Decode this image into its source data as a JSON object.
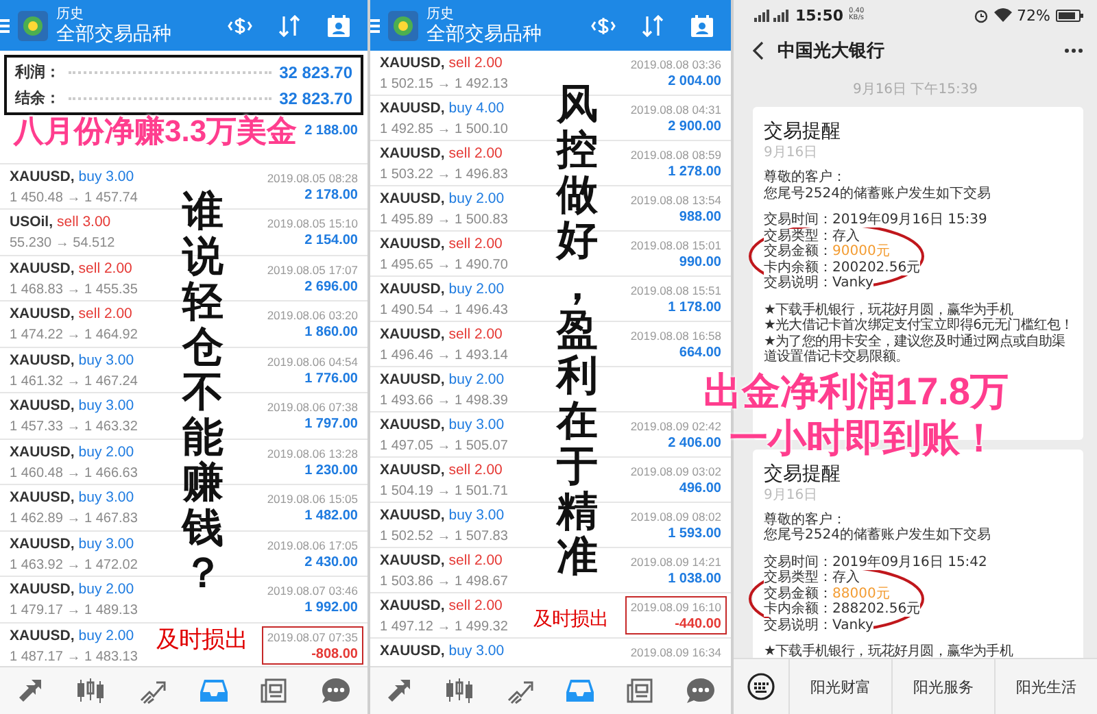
{
  "panels": [
    {
      "kind": "history",
      "header": {
        "subtitle": "历史",
        "title": "全部交易品种"
      },
      "summary": [
        {
          "label": "利润：",
          "value": "32 823.70"
        },
        {
          "label": "结余：",
          "value": "32 823.70"
        }
      ],
      "trades": [
        {
          "profit": "2 188.00",
          "loss": false,
          "flagged": false
        },
        {
          "symbol": "XAUUSD,",
          "color": "#1e7be0",
          "order": "buy 3.00",
          "prices": "1 450.48 → 1 457.74",
          "time": "2019.08.05 08:28",
          "profit": "2 178.00",
          "loss": false,
          "flagged": false
        },
        {
          "symbol": "USOil,",
          "color": "#e53935",
          "order": "sell 3.00",
          "prices": "55.230 → 54.512",
          "time": "2019.08.05 15:10",
          "profit": "2 154.00",
          "loss": false,
          "flagged": false
        },
        {
          "symbol": "XAUUSD,",
          "color": "#e53935",
          "order": "sell 2.00",
          "prices": "1 468.83 → 1 455.35",
          "time": "2019.08.05 17:07",
          "profit": "2 696.00",
          "loss": false,
          "flagged": false
        },
        {
          "symbol": "XAUUSD,",
          "color": "#e53935",
          "order": "sell 2.00",
          "prices": "1 474.22 → 1 464.92",
          "time": "2019.08.06 03:20",
          "profit": "1 860.00",
          "loss": false,
          "flagged": false
        },
        {
          "symbol": "XAUUSD,",
          "color": "#1e7be0",
          "order": "buy 3.00",
          "prices": "1 461.32 → 1 467.24",
          "time": "2019.08.06 04:54",
          "profit": "1 776.00",
          "loss": false,
          "flagged": false
        },
        {
          "symbol": "XAUUSD,",
          "color": "#1e7be0",
          "order": "buy 3.00",
          "prices": "1 457.33 → 1 463.32",
          "time": "2019.08.06 07:38",
          "profit": "1 797.00",
          "loss": false,
          "flagged": false
        },
        {
          "symbol": "XAUUSD,",
          "color": "#1e7be0",
          "order": "buy 2.00",
          "prices": "1 460.48 → 1 466.63",
          "time": "2019.08.06 13:28",
          "profit": "1 230.00",
          "loss": false,
          "flagged": false
        },
        {
          "symbol": "XAUUSD,",
          "color": "#1e7be0",
          "order": "buy 3.00",
          "prices": "1 462.89 → 1 467.83",
          "time": "2019.08.06 15:05",
          "profit": "1 482.00",
          "loss": false,
          "flagged": false
        },
        {
          "symbol": "XAUUSD,",
          "color": "#1e7be0",
          "order": "buy 3.00",
          "prices": "1 463.92 → 1 472.02",
          "time": "2019.08.06 17:05",
          "profit": "2 430.00",
          "loss": false,
          "flagged": false
        },
        {
          "symbol": "XAUUSD,",
          "color": "#1e7be0",
          "order": "buy 2.00",
          "prices": "1 479.17 → 1 489.13",
          "time": "2019.08.07 03:46",
          "profit": "1 992.00",
          "loss": false,
          "flagged": false
        },
        {
          "symbol": "XAUUSD,",
          "color": "#1e7be0",
          "order": "buy 2.00",
          "prices": "1 487.17 → 1 483.13",
          "time": "2019.08.07 07:35",
          "profit": "-808.00",
          "loss": true,
          "flagged": true
        }
      ],
      "nav": [
        {
          "selected": false
        },
        {
          "selected": false
        },
        {
          "selected": false
        },
        {
          "selected": true
        },
        {
          "selected": false
        },
        {
          "selected": false
        }
      ]
    },
    {
      "kind": "history",
      "header": {
        "subtitle": "历史",
        "title": "全部交易品种"
      },
      "trades": [
        {
          "symbol": "XAUUSD,",
          "color": "#e53935",
          "order": "sell 2.00",
          "prices": "1 502.15 → 1 492.13",
          "time": "2019.08.08 03:36",
          "profit": "2 004.00",
          "loss": false,
          "flagged": false
        },
        {
          "symbol": "XAUUSD,",
          "color": "#1e7be0",
          "order": "buy 4.00",
          "prices": "1 492.85 → 1 500.10",
          "time": "2019.08.08 04:31",
          "profit": "2 900.00",
          "loss": false,
          "flagged": false
        },
        {
          "symbol": "XAUUSD,",
          "color": "#e53935",
          "order": "sell 2.00",
          "prices": "1 503.22 → 1 496.83",
          "time": "2019.08.08 08:59",
          "profit": "1 278.00",
          "loss": false,
          "flagged": false
        },
        {
          "symbol": "XAUUSD,",
          "color": "#1e7be0",
          "order": "buy 2.00",
          "prices": "1 495.89 → 1 500.83",
          "time": "2019.08.08 13:54",
          "profit": "988.00",
          "loss": false,
          "flagged": false
        },
        {
          "symbol": "XAUUSD,",
          "color": "#e53935",
          "order": "sell 2.00",
          "prices": "1 495.65 → 1 490.70",
          "time": "2019.08.08 15:01",
          "profit": "990.00",
          "loss": false,
          "flagged": false
        },
        {
          "symbol": "XAUUSD,",
          "color": "#1e7be0",
          "order": "buy 2.00",
          "prices": "1 490.54 → 1 496.43",
          "time": "2019.08.08 15:51",
          "profit": "1 178.00",
          "loss": false,
          "flagged": false
        },
        {
          "symbol": "XAUUSD,",
          "color": "#e53935",
          "order": "sell 2.00",
          "prices": "1 496.46 → 1 493.14",
          "time": "2019.08.08 16:58",
          "profit": "664.00",
          "loss": false,
          "flagged": false
        },
        {
          "symbol": "XAUUSD,",
          "color": "#1e7be0",
          "order": "buy 2.00",
          "prices": "1 493.66 → 1 498.39",
          "flagged": false
        },
        {
          "symbol": "XAUUSD,",
          "color": "#1e7be0",
          "order": "buy 3.00",
          "prices": "1 497.05 → 1 505.07",
          "time": "2019.08.09 02:42",
          "profit": "2 406.00",
          "loss": false,
          "flagged": false
        },
        {
          "symbol": "XAUUSD,",
          "color": "#e53935",
          "order": "sell 2.00",
          "prices": "1 504.19 → 1 501.71",
          "time": "2019.08.09 03:02",
          "profit": "496.00",
          "loss": false,
          "flagged": false
        },
        {
          "symbol": "XAUUSD,",
          "color": "#1e7be0",
          "order": "buy 3.00",
          "prices": "1 502.52 → 1 507.83",
          "time": "2019.08.09 08:02",
          "profit": "1 593.00",
          "loss": false,
          "flagged": false
        },
        {
          "symbol": "XAUUSD,",
          "color": "#e53935",
          "order": "sell 2.00",
          "prices": "1 503.86 → 1 498.67",
          "time": "2019.08.09 14:21",
          "profit": "1 038.00",
          "loss": false,
          "flagged": false
        },
        {
          "symbol": "XAUUSD,",
          "color": "#e53935",
          "order": "sell 2.00",
          "prices": "1 497.12 → 1 499.32",
          "time": "2019.08.09 16:10",
          "profit": "-440.00",
          "loss": true,
          "flagged": true
        },
        {
          "symbol": "XAUUSD,",
          "color": "#1e7be0",
          "order": "buy 3.00",
          "time": "2019.08.09 16:34",
          "flagged": false
        }
      ],
      "nav": [
        {
          "selected": false
        },
        {
          "selected": false
        },
        {
          "selected": false
        },
        {
          "selected": true
        },
        {
          "selected": false
        },
        {
          "selected": false
        }
      ]
    },
    {
      "kind": "bank",
      "status_bar": {
        "time": "15:50",
        "speed": "0.40 KB/s",
        "battery": "72%"
      },
      "title": "中国光大银行",
      "timestamp": "9月16日 下午15:39",
      "messages": [
        {
          "title": "交易提醒",
          "date": "9月16日",
          "annotated": true,
          "intro": [
            "尊敬的客户：",
            "您尾号2524的储蓄账户发生如下交易"
          ],
          "fields": [
            {
              "label": "交易时间：",
              "value": "2019年09月16日  15:39",
              "highlight": false
            },
            {
              "label": "交易类型：",
              "value": "存入",
              "highlight": false
            },
            {
              "label": "交易金额：",
              "value": "90000元",
              "highlight": true
            },
            {
              "label": "卡内余额：",
              "value": "200202.56元",
              "highlight": false
            },
            {
              "label": "交易说明：",
              "value": "Vanky",
              "highlight": false
            }
          ],
          "notes": [
            "★下载手机银行，玩花好月圆，赢华为手机",
            "★光大借记卡首次绑定支付宝立即得6元无门槛红包！",
            "★为了您的用卡安全，建议您及时通过网点或自助渠道设置借记卡交易限额。"
          ]
        },
        {
          "title": "交易提醒",
          "date": "9月16日",
          "annotated": true,
          "intro": [
            "尊敬的客户：",
            "您尾号2524的储蓄账户发生如下交易"
          ],
          "fields": [
            {
              "label": "交易时间：",
              "value": "2019年09月16日  15:42",
              "highlight": false
            },
            {
              "label": "交易类型：",
              "value": "存入",
              "highlight": false
            },
            {
              "label": "交易金额：",
              "value": "88000元",
              "highlight": true
            },
            {
              "label": "卡内余额：",
              "value": "288202.56元",
              "highlight": false
            },
            {
              "label": "交易说明：",
              "value": "Vanky",
              "highlight": false
            }
          ],
          "notes": [
            "★下载手机银行，玩花好月圆，赢华为手机"
          ]
        }
      ],
      "menu": [
        "阳光财富",
        "阳光服务",
        "阳光生活"
      ]
    }
  ],
  "overlays": [
    {
      "kind": "banner",
      "text": "八月份净赚3.3万美金"
    },
    {
      "kind": "vertical",
      "text": "谁说轻仓不能赚钱？"
    },
    {
      "kind": "note",
      "text": "及时损出"
    },
    {
      "kind": "vertical",
      "text": "风控做好，盈利在于精准"
    },
    {
      "kind": "note",
      "text": "及时损出"
    },
    {
      "kind": "banner",
      "text": "出金净利润17.8万"
    },
    {
      "kind": "banner",
      "text": "一小时即到账！"
    }
  ]
}
